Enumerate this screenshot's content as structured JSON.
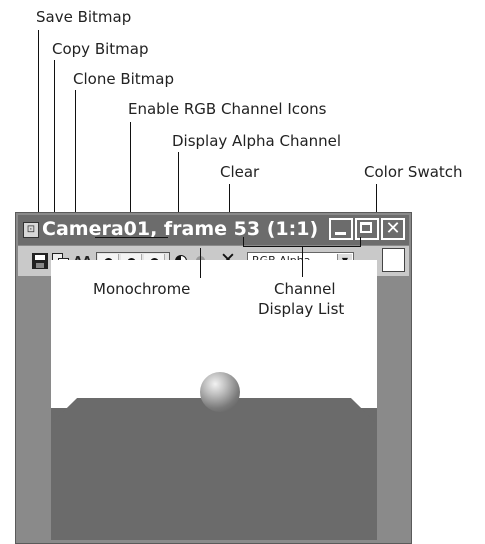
{
  "annotations": {
    "save": "Save Bitmap",
    "copy": "Copy Bitmap",
    "clone": "Clone Bitmap",
    "enable_rgb": "Enable RGB Channel Icons",
    "display_alpha": "Display Alpha Channel",
    "clear": "Clear",
    "color_swatch": "Color Swatch",
    "monochrome": "Monochrome",
    "channel_list_line1": "Channel",
    "channel_list_line2": "Display List"
  },
  "window": {
    "title": "Camera01, frame 53 (1:1)",
    "close_glyph": "✕"
  },
  "toolbar": {
    "channel_select_value": "RGB Alpha",
    "clone_glyph": "ΔΔ",
    "clear_glyph": "✕",
    "dropdown_glyph": "▼"
  },
  "colors": {
    "swatch": "#ffffff",
    "titlebar": "#6c6c6c",
    "floor": "#6b6b6b"
  }
}
